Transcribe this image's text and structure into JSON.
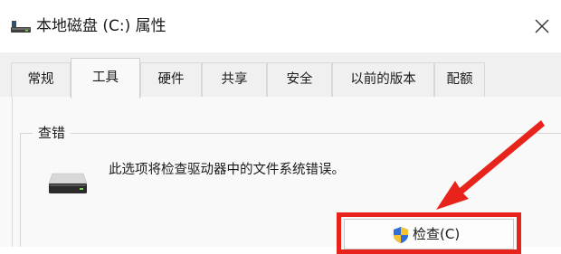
{
  "window": {
    "title": "本地磁盘 (C:) 属性",
    "close_glyph": "✕"
  },
  "tabs": [
    {
      "label": "常规",
      "active": false
    },
    {
      "label": "工具",
      "active": true
    },
    {
      "label": "硬件",
      "active": false
    },
    {
      "label": "共享",
      "active": false
    },
    {
      "label": "安全",
      "active": false
    },
    {
      "label": "以前的版本",
      "active": false
    },
    {
      "label": "配额",
      "active": false
    }
  ],
  "error_checking": {
    "group_label": "查错",
    "description": "此选项将检查驱动器中的文件系统错误。",
    "check_button_label": "检查(C)"
  },
  "annotation": {
    "highlight_color": "#e8231b"
  }
}
